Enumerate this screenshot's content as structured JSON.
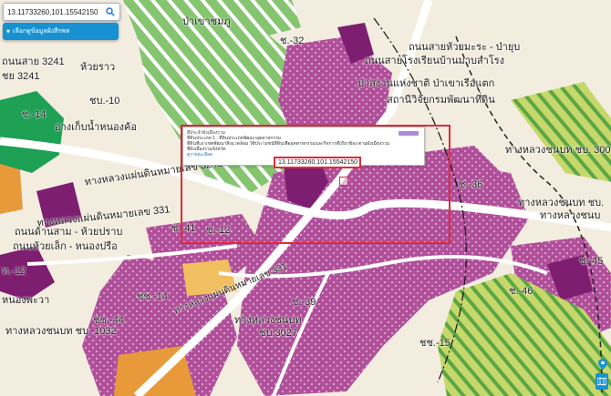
{
  "search": {
    "value": "13.11733260,101.15542150",
    "icon": "search-icon"
  },
  "layer_button": {
    "label": "เลือกดูข้อมูลผังสีรพห",
    "icon": "chevron-down-icon"
  },
  "popup": {
    "title": "สีประจำผังเมืองรวม",
    "line1": "ที่ดินประเภท 1 : ที่ดินประเภทพัฒนาอุตสาหกรรม",
    "line2": "ที่ดินที่เอาเขตพัฒนาสิ่งแวดล้อม ใช้ประโยชน์ที่ดินเพื่ออุตสาหกรรมและกิจการที่เกี่ยวข้อง ตามผังเมืองรวม",
    "line3": "ที่ผังเมืองรวมจังหวัด",
    "link": "ดูรายละเอียด",
    "coordinate": "13.11733260,101.15542150"
  },
  "map_labels": {
    "l1": "ป่าเขาชมภู",
    "l2": "ช.-32",
    "l3": "ถนนสายหัวยมะระ - ป่ายุบ",
    "l4": "ถนนสายโรงเรียนบ้านมาบสำโรง",
    "l5": "ถนนสาย 3241",
    "l6": "ห้วยราว",
    "l7": "ชย 3241",
    "l8": "ชบ.-10",
    "l9": "ช.-14",
    "l10": "อ่างเก็บน้ำหนองค้อ",
    "l11": "ป่าสงวนแห่งชาติ ป่าเขาเรือแตก",
    "l12": "สถานีวิจัยกรมพัฒนาที่ดิน",
    "l13": "ทางหลวงชนบท ชบ. 3007",
    "l14": "ทางหลวงแผ่นดินหมายเลข 3241",
    "l15": "ทางหลวงแผ่นดินหมายเลข 331",
    "l16": "ทางหลวงชนบท ชบ.",
    "l17": "ทางหลวงชนบ",
    "l18": "ช.-36",
    "l19": "ถนนด้านสาม - ห้วยปราบ",
    "l20": "ถนนห้วยเล็ก - หนองปรือ",
    "l21": "ช.-41",
    "l22": "ช.-12",
    "l23": "ช.-39",
    "l24": "ชช.-14",
    "l25": "ชช.-44",
    "l26": "ทางหลวงชนบท",
    "l27": "ชบ.3027",
    "l28": "ชช.-15",
    "l29": "ช.-46",
    "l30": "ช.-45",
    "l31": "ทางหลวงแผ่นดินหมายเลข 331",
    "l32": "ทางหลวงชนบท ชบ. 1032",
    "l33": "ท.-12",
    "l34": "หนองพะวา"
  },
  "colors": {
    "base": "#f3eddf",
    "industrial_purple": "#b0509a",
    "dark_purple": "#7d1e70",
    "forest_green": "#86c570",
    "agri_stripe": "#c6d86a",
    "orange": "#e89a3a",
    "water": "#1ea055",
    "road": "#ffffff",
    "highlight": "#e02a3a"
  }
}
